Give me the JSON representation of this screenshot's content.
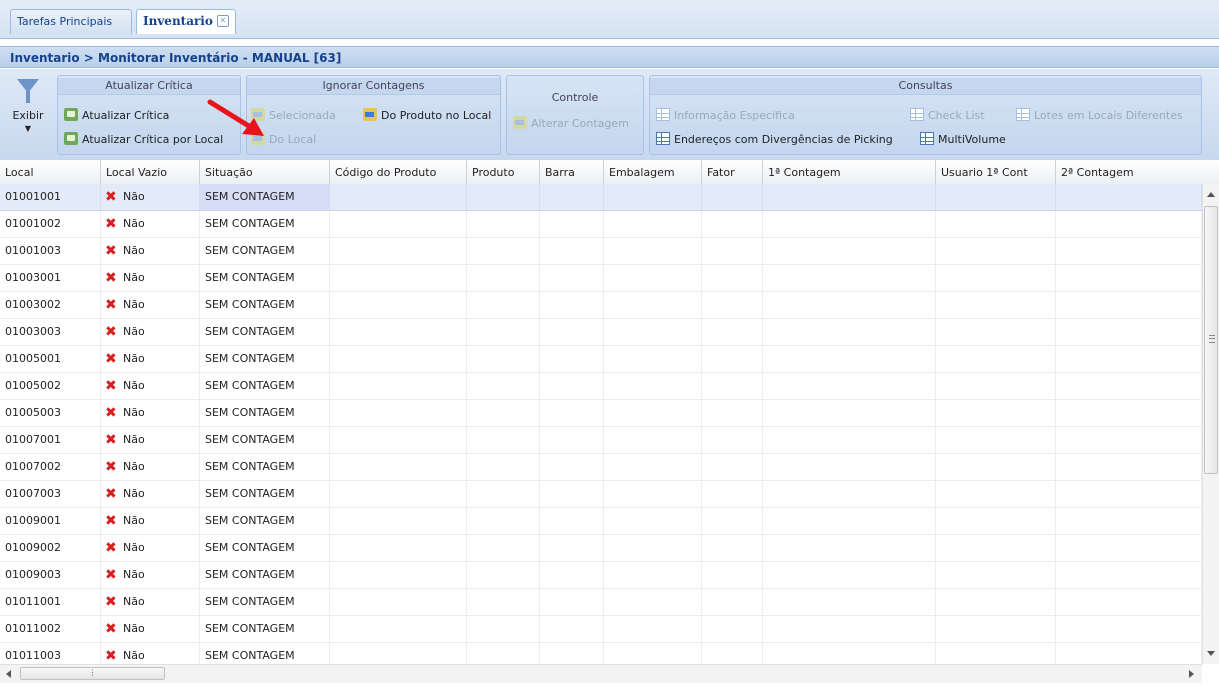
{
  "tabs": [
    {
      "label": "Tarefas Principais"
    },
    {
      "label": "Inventario",
      "close": "✕"
    }
  ],
  "breadcrumb": "Inventario > Monitorar Inventário - MANUAL [63]",
  "toolbar": {
    "exibir": "Exibir",
    "atualizar": {
      "title": "Atualizar Crítica",
      "btn1": "Atualizar Crítica",
      "btn2": "Atualizar Crítica por Local"
    },
    "ignorar": {
      "title": "Ignorar Contagens",
      "btn1": "Selecionada",
      "btn2": "Do Produto no Local",
      "btn3": "Do Local"
    },
    "controle": {
      "title": "Controle",
      "btn1": "Alterar Contagem"
    },
    "consultas": {
      "title": "Consultas",
      "btn1": "Informação Específica",
      "btn2": "Check List",
      "btn3": "Lotes em Locais Diferentes",
      "btn4": "Endereços com Divergências de Picking",
      "btn5": "MultiVolume"
    }
  },
  "columns": [
    "Local",
    "Local Vazio",
    "Situação",
    "Código do Produto",
    "Produto",
    "Barra",
    "Embalagem",
    "Fator",
    "1ª Contagem",
    "Usuario 1ª Cont",
    "2ª Contagem"
  ],
  "rows": [
    {
      "local": "01001001",
      "vazio": "Não",
      "situacao": "SEM CONTAGEM"
    },
    {
      "local": "01001002",
      "vazio": "Não",
      "situacao": "SEM CONTAGEM"
    },
    {
      "local": "01001003",
      "vazio": "Não",
      "situacao": "SEM CONTAGEM"
    },
    {
      "local": "01003001",
      "vazio": "Não",
      "situacao": "SEM CONTAGEM"
    },
    {
      "local": "01003002",
      "vazio": "Não",
      "situacao": "SEM CONTAGEM"
    },
    {
      "local": "01003003",
      "vazio": "Não",
      "situacao": "SEM CONTAGEM"
    },
    {
      "local": "01005001",
      "vazio": "Não",
      "situacao": "SEM CONTAGEM"
    },
    {
      "local": "01005002",
      "vazio": "Não",
      "situacao": "SEM CONTAGEM"
    },
    {
      "local": "01005003",
      "vazio": "Não",
      "situacao": "SEM CONTAGEM"
    },
    {
      "local": "01007001",
      "vazio": "Não",
      "situacao": "SEM CONTAGEM"
    },
    {
      "local": "01007002",
      "vazio": "Não",
      "situacao": "SEM CONTAGEM"
    },
    {
      "local": "01007003",
      "vazio": "Não",
      "situacao": "SEM CONTAGEM"
    },
    {
      "local": "01009001",
      "vazio": "Não",
      "situacao": "SEM CONTAGEM"
    },
    {
      "local": "01009002",
      "vazio": "Não",
      "situacao": "SEM CONTAGEM"
    },
    {
      "local": "01009003",
      "vazio": "Não",
      "situacao": "SEM CONTAGEM"
    },
    {
      "local": "01011001",
      "vazio": "Não",
      "situacao": "SEM CONTAGEM"
    },
    {
      "local": "01011002",
      "vazio": "Não",
      "situacao": "SEM CONTAGEM"
    }
  ],
  "partial_row": {
    "local": "01011003",
    "vazio": "Não",
    "situacao": "SEM CONTAGEM"
  },
  "colors": {
    "accent": "#15428b",
    "annotation_arrow": "#e8141b",
    "x_mark": "#d42020",
    "selected_row": "#e2ebf7"
  },
  "icons": [
    "funnel-icon",
    "refresh-icon",
    "ignore-icon",
    "table-icon",
    "close-icon",
    "x-mark-icon",
    "red-arrow-annotation"
  ]
}
